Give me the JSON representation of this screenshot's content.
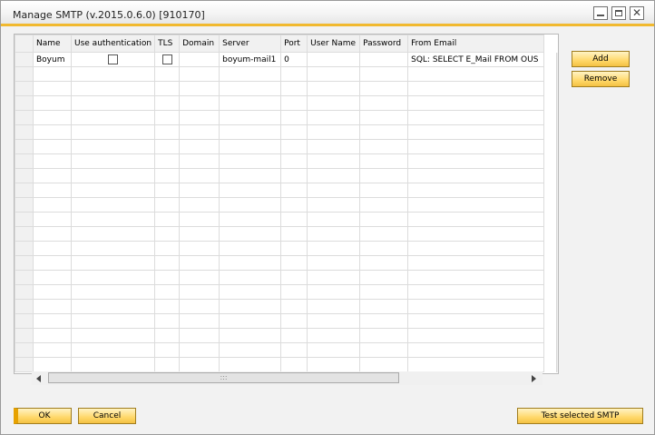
{
  "window": {
    "title": "Manage SMTP (v.2015.0.6.0) [910170]"
  },
  "grid": {
    "columns": [
      "Name",
      "Use authentication",
      "TLS",
      "Domain",
      "Server",
      "Port",
      "User Name",
      "Password",
      "From Email"
    ],
    "rows": [
      {
        "name": "Boyum",
        "use_authentication": false,
        "tls": false,
        "domain": "",
        "server": "boyum-mail1",
        "port": "0",
        "user_name": "",
        "password": "",
        "from_email": "SQL: SELECT E_Mail FROM OUS"
      }
    ],
    "scroll_thumb_grip": ":::"
  },
  "buttons": {
    "add": "Add",
    "remove": "Remove",
    "ok": "OK",
    "cancel": "Cancel",
    "test": "Test selected SMTP"
  },
  "colors": {
    "accent_bar": "#f1b92f",
    "button_fill": "#ffd86a",
    "ok_marker": "#e7a200"
  }
}
